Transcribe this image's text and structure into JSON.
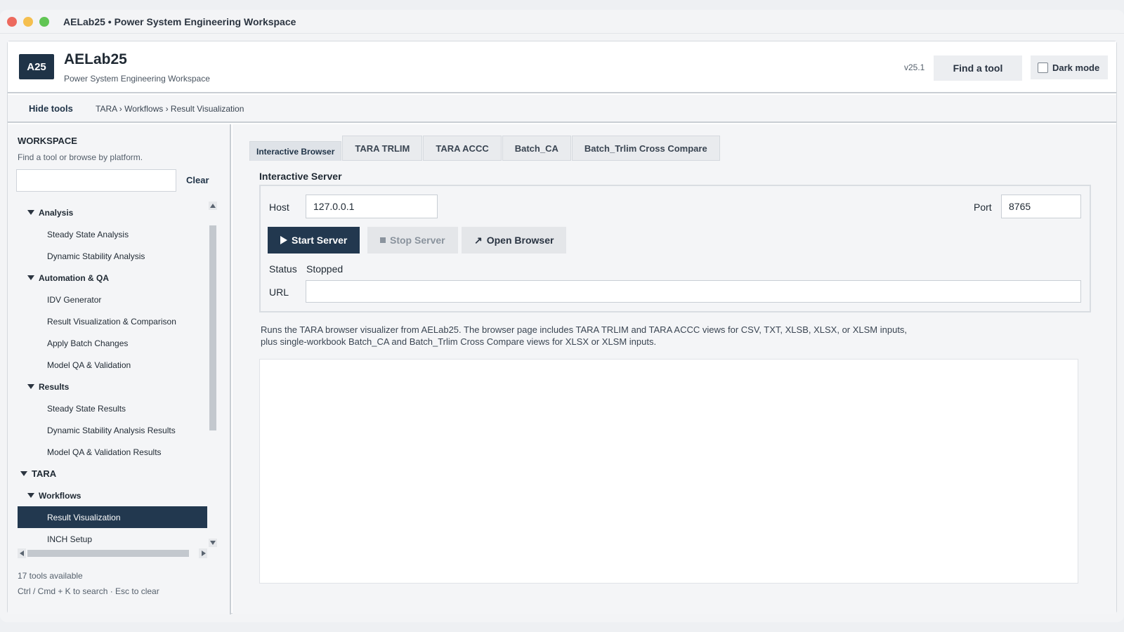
{
  "window": {
    "title": "AELab25 • Power System Engineering Workspace",
    "traffic_colors": [
      "#ed6a5e",
      "#f5bf4f",
      "#61c554"
    ]
  },
  "header": {
    "logo": "A25",
    "app_name": "AELab25",
    "app_subtitle": "Power System Engineering Workspace",
    "version": "v25.1",
    "find_tool_label": "Find a tool",
    "dark_mode_label": "Dark mode",
    "dark_mode_checked": false
  },
  "subbar": {
    "hide_tools_label": "Hide tools",
    "breadcrumb": "TARA › Workflows › Result Visualization"
  },
  "sidebar": {
    "title": "WORKSPACE",
    "subtitle": "Find a tool or browse by platform.",
    "search_value": "",
    "clear_label": "Clear",
    "tree": [
      {
        "label": "Analysis",
        "level": 1,
        "kind": "group"
      },
      {
        "label": "Steady State Analysis",
        "level": 2,
        "kind": "item"
      },
      {
        "label": "Dynamic Stability Analysis",
        "level": 2,
        "kind": "item"
      },
      {
        "label": "Automation & QA",
        "level": 1,
        "kind": "group"
      },
      {
        "label": "IDV Generator",
        "level": 2,
        "kind": "item"
      },
      {
        "label": "Result Visualization & Comparison",
        "level": 2,
        "kind": "item"
      },
      {
        "label": "Apply Batch Changes",
        "level": 2,
        "kind": "item"
      },
      {
        "label": "Model QA & Validation",
        "level": 2,
        "kind": "item"
      },
      {
        "label": "Results",
        "level": 1,
        "kind": "group"
      },
      {
        "label": "Steady State Results",
        "level": 2,
        "kind": "item"
      },
      {
        "label": "Dynamic Stability Analysis Results",
        "level": 2,
        "kind": "item"
      },
      {
        "label": "Model QA & Validation Results",
        "level": 2,
        "kind": "item"
      },
      {
        "label": "TARA",
        "level": 0,
        "kind": "root"
      },
      {
        "label": "Workflows",
        "level": 1,
        "kind": "group"
      },
      {
        "label": "Result Visualization",
        "level": 2,
        "kind": "item",
        "selected": true
      },
      {
        "label": "INCH Setup",
        "level": 2,
        "kind": "item"
      }
    ],
    "tools_count": "17 tools available",
    "shortcut_hint": "Ctrl / Cmd + K to search · Esc to clear"
  },
  "main": {
    "tabs": [
      {
        "label": "Interactive Browser",
        "active": true
      },
      {
        "label": "TARA TRLIM",
        "active": false
      },
      {
        "label": "TARA ACCC",
        "active": false
      },
      {
        "label": "Batch_CA",
        "active": false
      },
      {
        "label": "Batch_Trlim Cross Compare",
        "active": false
      }
    ],
    "section_title": "Interactive Server",
    "host_label": "Host",
    "host_value": "127.0.0.1",
    "port_label": "Port",
    "port_value": "8765",
    "start_label": "Start Server",
    "stop_label": "Stop Server",
    "open_label": "Open Browser",
    "status_label": "Status",
    "status_value": "Stopped",
    "url_label": "URL",
    "url_value": "",
    "description_line1": "Runs the TARA browser visualizer from AELab25. The browser page includes TARA TRLIM and TARA ACCC views for CSV, TXT, XLSB, XLSX, or XLSM inputs,",
    "description_line2": "plus single-workbook Batch_CA and Batch_Trlim Cross Compare views for XLSX or XLSM inputs."
  }
}
